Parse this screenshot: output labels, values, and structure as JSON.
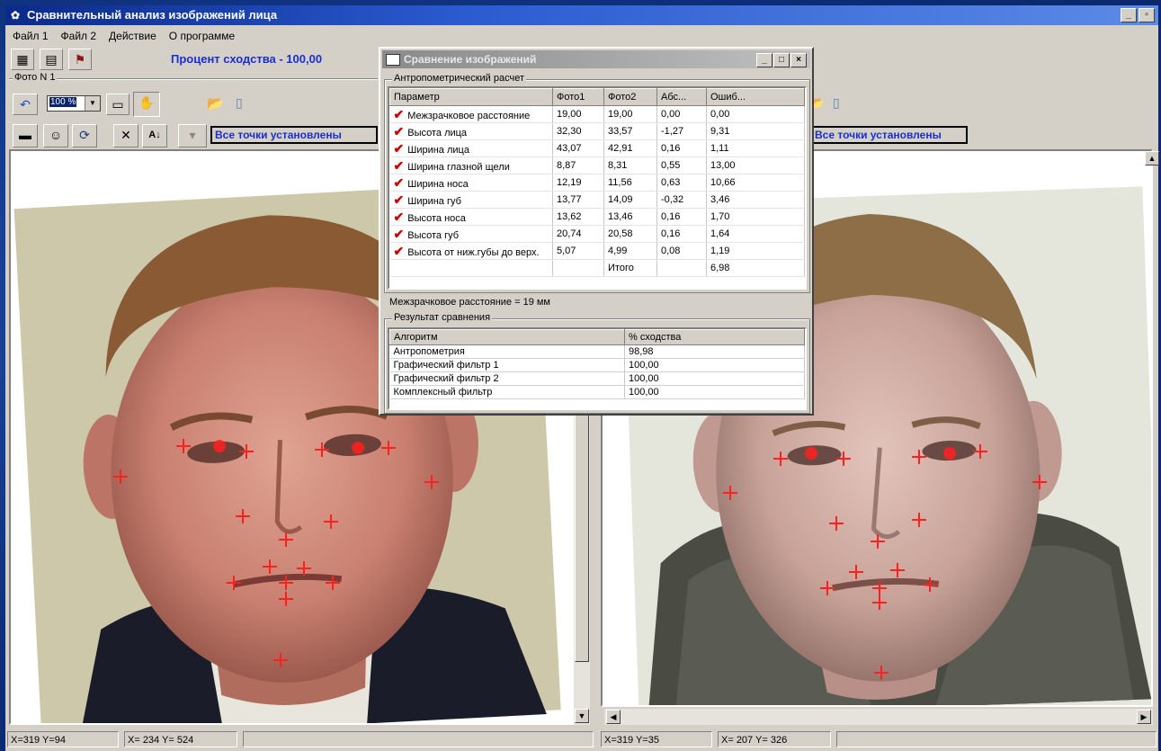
{
  "window": {
    "title": "Сравнительный анализ изображений лица"
  },
  "menu": [
    "Файл 1",
    "Файл 2",
    "Действие",
    "О программе"
  ],
  "toolbar": {
    "percent_text": "Процент сходства - 100,00"
  },
  "left": {
    "group_label": "Фото N 1",
    "zoom": "100 %",
    "status": "Все точки установлены",
    "statusbar": [
      "X=319 Y=94",
      "X= 234  Y= 524"
    ]
  },
  "right": {
    "status": "Все точки установлены",
    "statusbar": [
      "X=319 Y=35",
      "X= 207  Y= 326"
    ]
  },
  "dialog": {
    "title": "Сравнение изображений",
    "group1": "Антропометрический расчет",
    "columns": [
      "Параметр",
      "Фото1",
      "Фото2",
      "Абс...",
      "Ошиб..."
    ],
    "rows": [
      {
        "name": "Межзрачковое расстояние",
        "f1": "19,00",
        "f2": "19,00",
        "abs": "0,00",
        "err": "0,00"
      },
      {
        "name": "Высота лица",
        "f1": "32,30",
        "f2": "33,57",
        "abs": "-1,27",
        "err": "9,31"
      },
      {
        "name": "Ширина лица",
        "f1": "43,07",
        "f2": "42,91",
        "abs": "0,16",
        "err": "1,11"
      },
      {
        "name": "Ширина глазной щели",
        "f1": "8,87",
        "f2": "8,31",
        "abs": "0,55",
        "err": "13,00"
      },
      {
        "name": "Ширина носа",
        "f1": "12,19",
        "f2": "11,56",
        "abs": "0,63",
        "err": "10,66"
      },
      {
        "name": "Ширина губ",
        "f1": "13,77",
        "f2": "14,09",
        "abs": "-0,32",
        "err": "3,46"
      },
      {
        "name": "Высота носа",
        "f1": "13,62",
        "f2": "13,46",
        "abs": "0,16",
        "err": "1,70"
      },
      {
        "name": "Высота губ",
        "f1": "20,74",
        "f2": "20,58",
        "abs": "0,16",
        "err": "1,64"
      },
      {
        "name": "Высота от ниж.губы до верх.",
        "f1": "5,07",
        "f2": "4,99",
        "abs": "0,08",
        "err": "1,19"
      }
    ],
    "total_label": "Итого",
    "total_value": "6,98",
    "interpupil_note": "Межзрачковое расстояние = 19 мм",
    "group2": "Результат сравнения",
    "result_columns": [
      "Алгоритм",
      "% сходства"
    ],
    "results": [
      {
        "algo": "Антропометрия",
        "pct": "98,98"
      },
      {
        "algo": "Графический фильтр 1",
        "pct": "100,00"
      },
      {
        "algo": "Графический фильтр 2",
        "pct": "100,00"
      },
      {
        "algo": "Комплексный фильтр",
        "pct": "100,00"
      }
    ]
  }
}
